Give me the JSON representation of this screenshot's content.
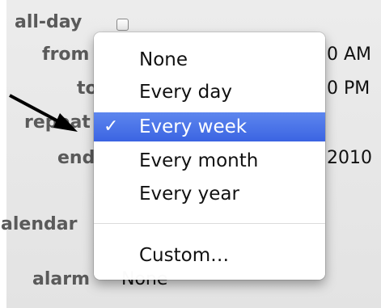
{
  "event_form": {
    "allday_label": "all-day",
    "from_label": "from",
    "to_label": "to",
    "repeat_label": "repeat",
    "end_label": "end",
    "calendar_label": "calendar",
    "alarm_label": "alarm",
    "from_value_suffix": "0 AM",
    "to_value_suffix": "0 PM",
    "end_value_suffix": "2010",
    "alarm_value": "None"
  },
  "repeat_menu": {
    "items": [
      {
        "label": "None",
        "selected": false
      },
      {
        "label": "Every day",
        "selected": false
      },
      {
        "label": "Every week",
        "selected": true
      },
      {
        "label": "Every month",
        "selected": false
      },
      {
        "label": "Every year",
        "selected": false
      }
    ],
    "custom_label": "Custom…",
    "checkmark": "✓"
  },
  "icons": {
    "arrow": "annotation-arrow-icon"
  },
  "colors": {
    "selection": "#3b64e2",
    "label_gray": "#5a5a5a"
  }
}
